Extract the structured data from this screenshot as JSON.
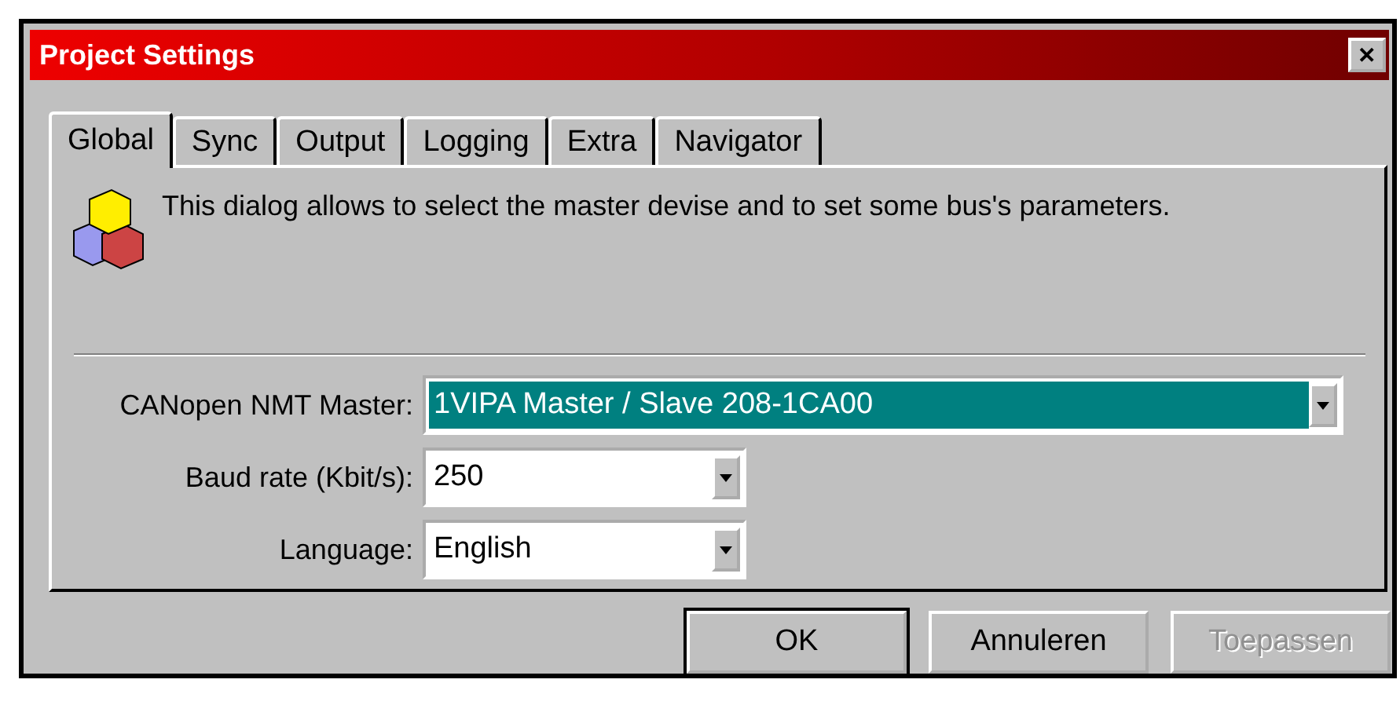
{
  "window": {
    "title": "Project Settings",
    "close": "✕"
  },
  "tabs": [
    {
      "label": "Global",
      "selected": true
    },
    {
      "label": "Sync",
      "selected": false
    },
    {
      "label": "Output",
      "selected": false
    },
    {
      "label": "Logging",
      "selected": false
    },
    {
      "label": "Extra",
      "selected": false
    },
    {
      "label": "Navigator",
      "selected": false
    }
  ],
  "description": "This dialog allows to select the master devise and to set some bus's parameters.",
  "fields": [
    {
      "label": "CANopen NMT Master:",
      "value": "1VIPA Master / Slave 208-1CA00",
      "highlighted": true,
      "wide": true
    },
    {
      "label": "Baud rate (Kbit/s):",
      "value": "250",
      "highlighted": false,
      "wide": false
    },
    {
      "label": "Language:",
      "value": "English",
      "highlighted": false,
      "wide": false
    }
  ],
  "buttons": [
    {
      "label": "OK",
      "default": true,
      "disabled": false
    },
    {
      "label": "Annuleren",
      "default": false,
      "disabled": false
    },
    {
      "label": "Toepassen",
      "default": false,
      "disabled": true
    }
  ]
}
